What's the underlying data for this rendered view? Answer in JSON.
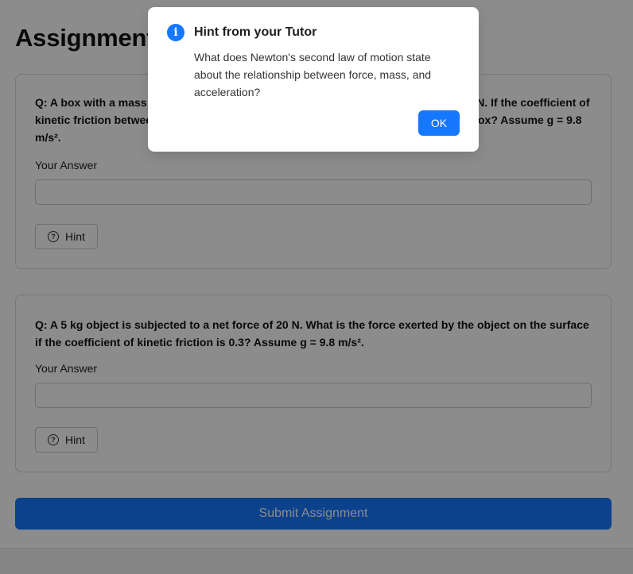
{
  "page": {
    "title": "Assignment",
    "submit_label": "Submit Assignment"
  },
  "questions": [
    {
      "text": "Q: A box with a mass of 10 kg is pushed across a horizontal floor with a force of 50 N. If the coefficient of kinetic friction between the box and the floor is 0.2, what is the acceleration of the box? Assume g = 9.8 m/s².",
      "answer_label": "Your Answer",
      "answer_value": "",
      "hint_label": "Hint"
    },
    {
      "text": "Q: A 5 kg object is subjected to a net force of 20 N. What is the force exerted by the object on the surface if the coefficient of kinetic friction is 0.3? Assume g = 9.8 m/s².",
      "answer_label": "Your Answer",
      "answer_value": "",
      "hint_label": "Hint"
    }
  ],
  "modal": {
    "icon": "info-icon",
    "title": "Hint from your Tutor",
    "body": "What does Newton's second law of motion state about the relationship between force, mass, and acceleration?",
    "ok_label": "OK"
  },
  "colors": {
    "accent": "#1677ff",
    "overlay": "rgba(0,0,0,0.45)"
  }
}
